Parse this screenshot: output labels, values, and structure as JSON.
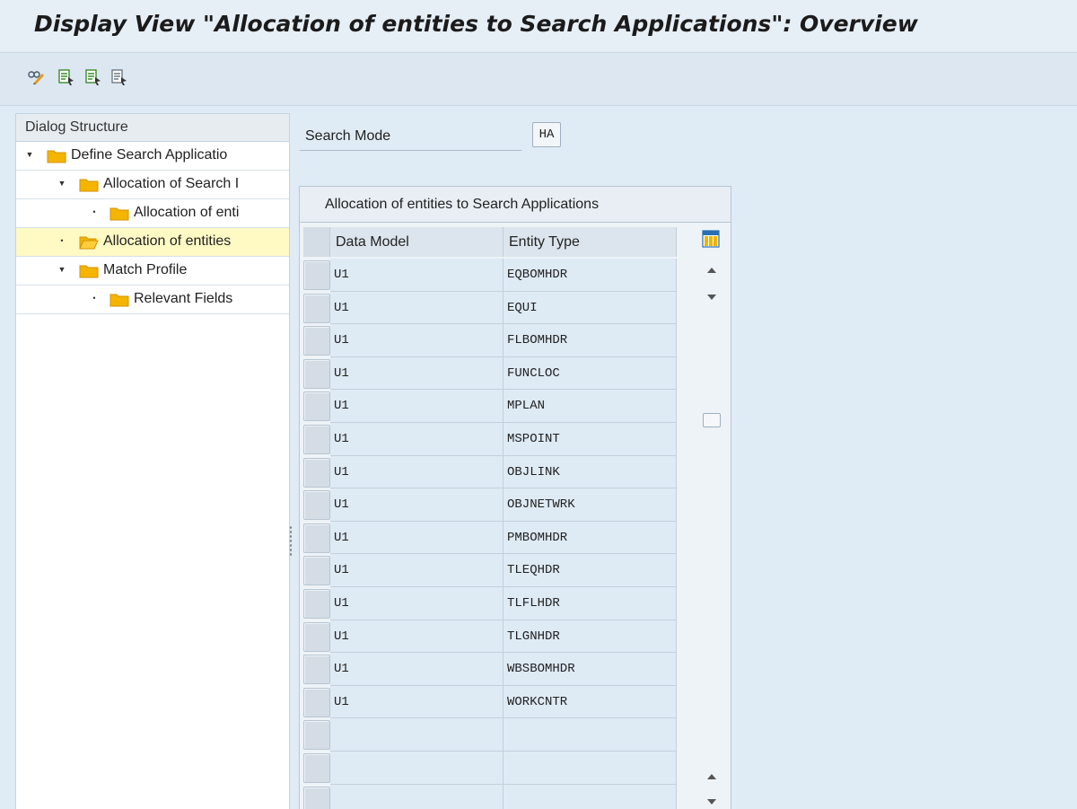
{
  "window": {
    "title": "Display View \"Allocation of entities to Search Applications\": Overview"
  },
  "toolbar": {
    "buttons": [
      {
        "icon": "display-change-icon"
      },
      {
        "icon": "variant-icon"
      },
      {
        "icon": "variant-icon"
      },
      {
        "icon": "variant-icon"
      }
    ]
  },
  "dialog_structure": {
    "header": "Dialog Structure",
    "items": [
      {
        "label": "Define Search Applicatio",
        "expander": "expanded",
        "level": 0
      },
      {
        "label": "Allocation of Search I",
        "expander": "expanded",
        "level": 1
      },
      {
        "label": "Allocation of enti",
        "expander": "leaf",
        "level": 2
      },
      {
        "label": "Allocation of entities",
        "expander": "leaf",
        "level": 0,
        "selected": true,
        "open_folder": true
      },
      {
        "label": "Match Profile",
        "expander": "expanded",
        "level": 0
      },
      {
        "label": "Relevant Fields",
        "expander": "leaf",
        "level": 1
      }
    ]
  },
  "search_mode": {
    "label": "Search Mode",
    "value": "HA"
  },
  "table": {
    "title": "Allocation of entities to Search Applications",
    "columns": [
      "Data Model",
      "Entity Type"
    ],
    "rows": [
      [
        "U1",
        "EQBOMHDR"
      ],
      [
        "U1",
        "EQUI"
      ],
      [
        "U1",
        "FLBOMHDR"
      ],
      [
        "U1",
        "FUNCLOC"
      ],
      [
        "U1",
        "MPLAN"
      ],
      [
        "U1",
        "MSPOINT"
      ],
      [
        "U1",
        "OBJLINK"
      ],
      [
        "U1",
        "OBJNETWRK"
      ],
      [
        "U1",
        "PMBOMHDR"
      ],
      [
        "U1",
        "TLEQHDR"
      ],
      [
        "U1",
        "TLFLHDR"
      ],
      [
        "U1",
        "TLGNHDR"
      ],
      [
        "U1",
        "WBSBOMHDR"
      ],
      [
        "U1",
        "WORKCNTR"
      ],
      [
        "",
        ""
      ],
      [
        "",
        ""
      ],
      [
        "",
        ""
      ]
    ]
  },
  "colors": {
    "background": "#dfebf5",
    "selected_row": "#fff9c4",
    "folder": "#f5b400",
    "cell": "#deeaf4"
  }
}
